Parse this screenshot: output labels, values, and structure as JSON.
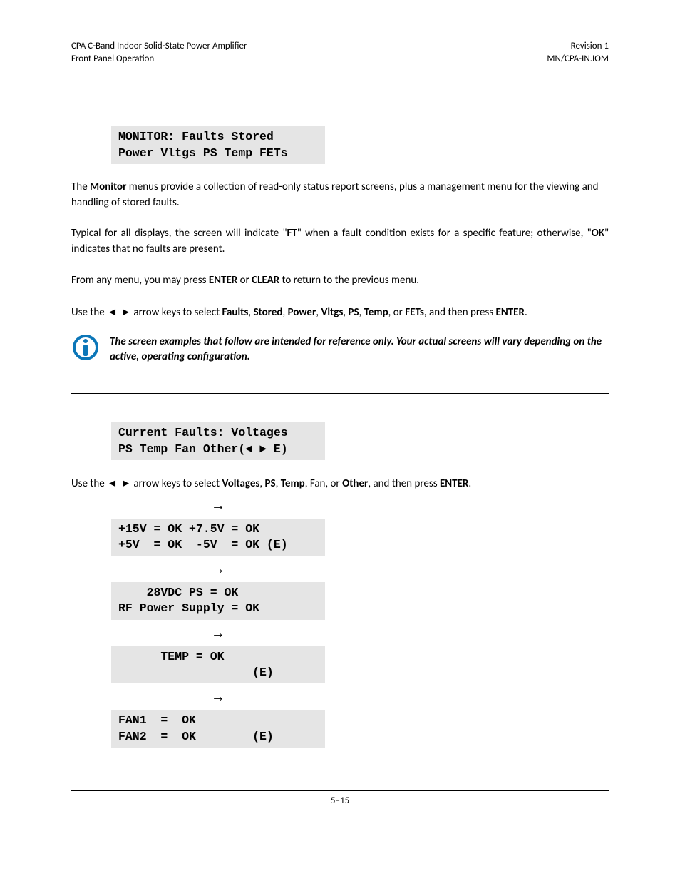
{
  "header": {
    "left_line1": "CPA C-Band Indoor Solid-State Power Amplifier",
    "left_line2": "Front Panel Operation",
    "right_line1": "Revision 1",
    "right_line2": "MN/CPA-IN.IOM"
  },
  "screen1": {
    "line1": "MONITOR: Faults Stored",
    "line2": "Power Vltgs PS Temp FETs"
  },
  "para1": {
    "t1": "The ",
    "b1": "Monitor",
    "t2": " menus provide a collection of read-only status report screens, plus a management menu for the viewing and handling of stored faults."
  },
  "para2": {
    "t1": "Typical for all displays, the screen will indicate \"",
    "b1": "FT",
    "t2": "\" when a fault condition exists for a specific feature; otherwise, \"",
    "b2": "OK",
    "t3": "\" indicates that no faults are present."
  },
  "para3": {
    "t1": "From any menu, you may press ",
    "b1": "ENTER",
    "t2": " or ",
    "b2": "CLEAR",
    "t3": " to return to the previous menu."
  },
  "para4": {
    "t1": "Use the ",
    "arrows": "◄ ►",
    "t2": " arrow keys to select ",
    "b1": "Faults",
    "c1": ", ",
    "b2": "Stored",
    "c2": ", ",
    "b3": "Power",
    "c3": ", ",
    "b4": "Vltgs",
    "c4": ", ",
    "b5": "PS",
    "c5": ", ",
    "b6": "Temp",
    "c6": ", or ",
    "b7": "FETs",
    "t3": ", and then press ",
    "b8": "ENTER",
    "t4": "."
  },
  "note": "The screen examples that follow are intended for reference only. Your actual screens will vary depending on the active, operating configuration.",
  "screen2": {
    "line1": "Current Faults: Voltages",
    "line2": "PS Temp Fan Other(◄ ► E)"
  },
  "para5": {
    "t1": "Use the ",
    "arrows": "◄ ►",
    "t2": " arrow keys to select ",
    "b1": "Voltages",
    "c1": ", ",
    "b2": "PS",
    "c2": ", ",
    "b3": "Temp",
    "c3": ", Fan, or ",
    "b4": "Other",
    "t3": ", and then press ",
    "b5": "ENTER",
    "t4": "."
  },
  "arrow": "→",
  "screen3": {
    "line1": "+15V = OK +7.5V = OK",
    "line2": "+5V  = OK  -5V  = OK (E)"
  },
  "screen4": {
    "line1": "    28VDC PS = OK",
    "line2": "RF Power Supply = OK"
  },
  "screen5": {
    "line1": "      TEMP = OK",
    "line2": "                   (E)"
  },
  "screen6": {
    "line1": "FAN1  =  OK",
    "line2": "FAN2  =  OK        (E)"
  },
  "footer": "5–15"
}
